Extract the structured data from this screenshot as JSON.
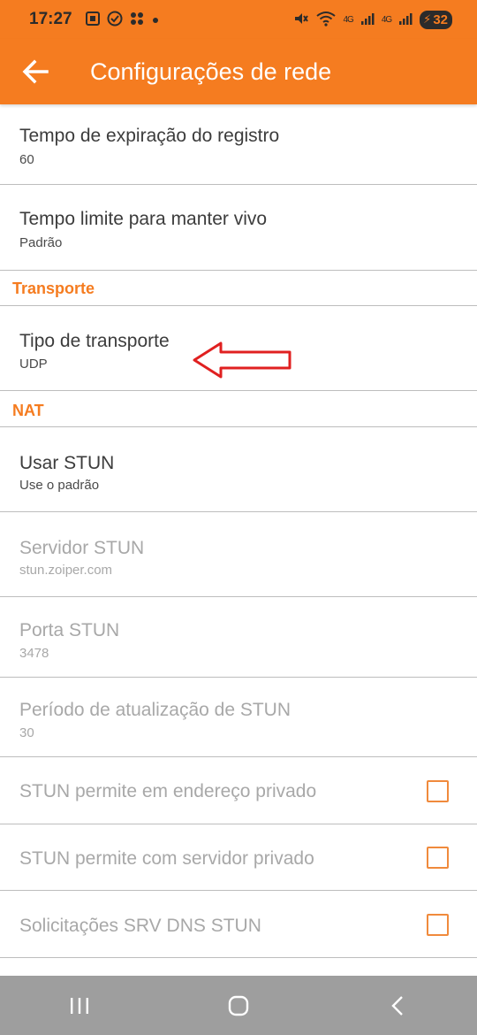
{
  "status_bar": {
    "time": "17:27",
    "battery": "32",
    "network_label_1": "4G",
    "network_label_2": "4G"
  },
  "app_bar": {
    "title": "Configurações de rede"
  },
  "settings": {
    "registration_expiry": {
      "title": "Tempo de expiração do registro",
      "value": "60"
    },
    "keep_alive": {
      "title": "Tempo limite para manter vivo",
      "value": "Padrão"
    },
    "section_transport": "Transporte",
    "transport_type": {
      "title": "Tipo de transporte",
      "value": "UDP"
    },
    "section_nat": "NAT",
    "use_stun": {
      "title": "Usar STUN",
      "value": "Use o padrão"
    },
    "stun_server": {
      "title": "Servidor STUN",
      "value": "stun.zoiper.com"
    },
    "stun_port": {
      "title": "Porta STUN",
      "value": "3478"
    },
    "stun_refresh": {
      "title": "Período de atualização de STUN",
      "value": "30"
    },
    "stun_private_address": {
      "title": "STUN permite em endereço privado",
      "checked": false
    },
    "stun_private_server": {
      "title": "STUN permite com servidor privado",
      "checked": false
    },
    "stun_srv_dns": {
      "title": "Solicitações SRV DNS STUN",
      "checked": false
    }
  },
  "colors": {
    "accent": "#f57c20",
    "annotation_arrow": "#e02020",
    "nav_bar": "#9e9e9e"
  }
}
